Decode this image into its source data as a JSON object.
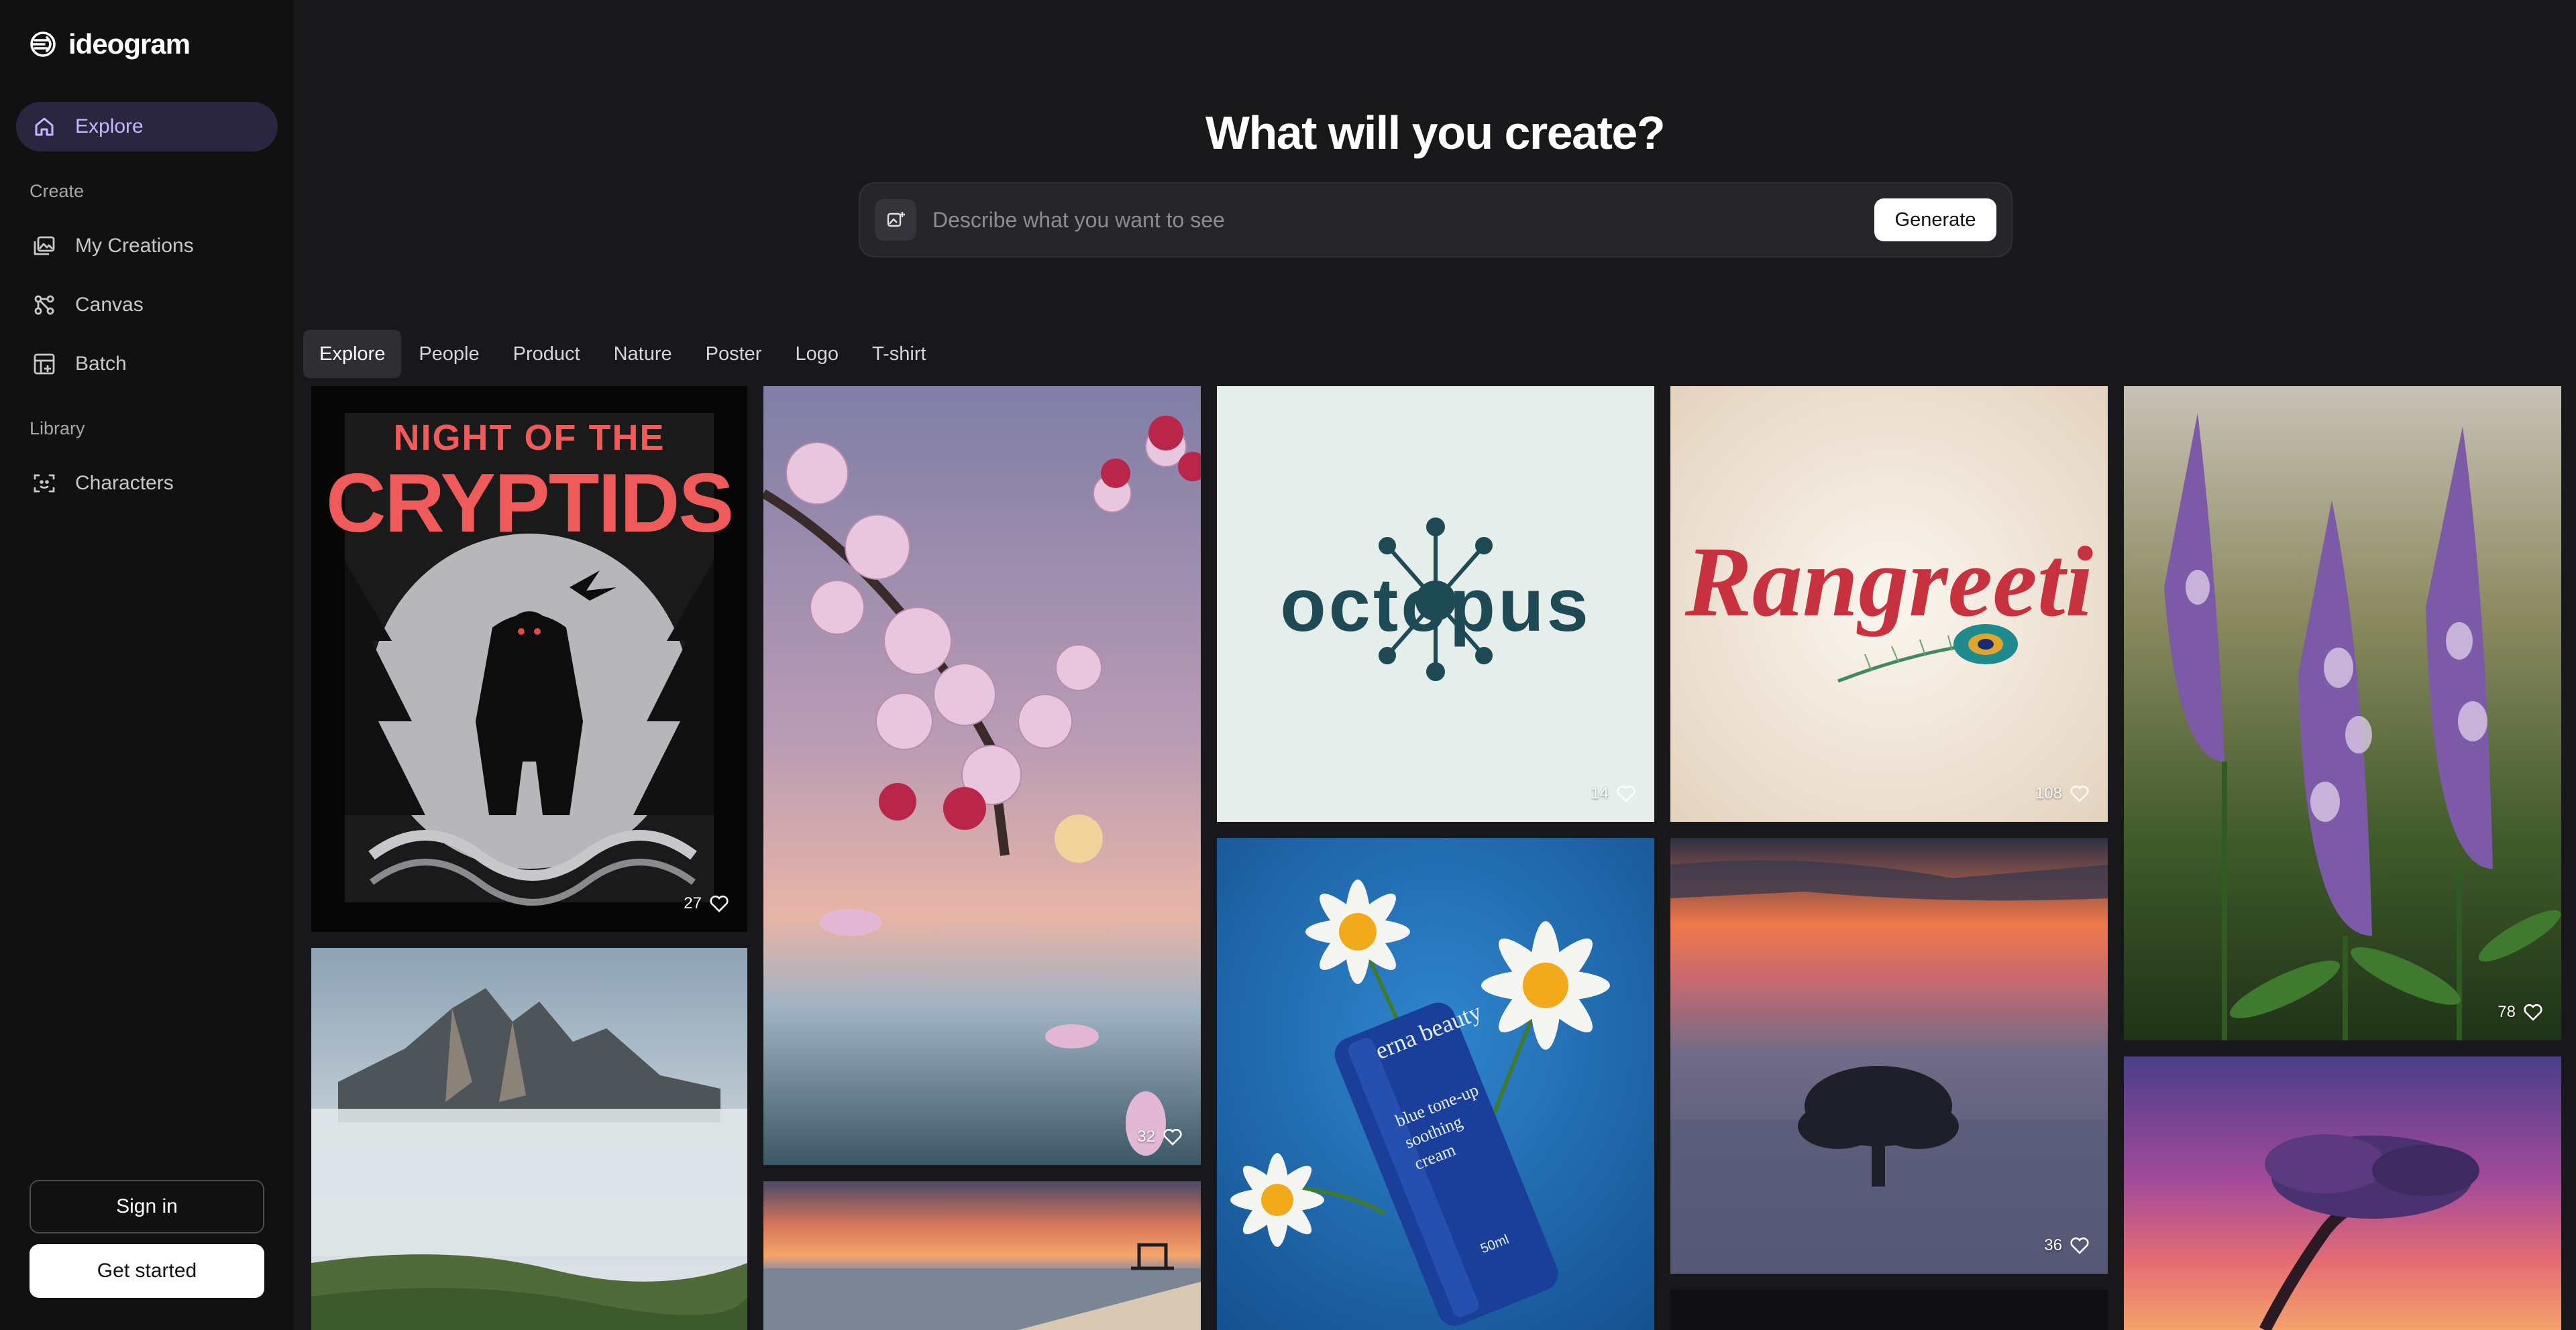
{
  "brand": {
    "name": "ideogram"
  },
  "sidebar": {
    "explore": "Explore",
    "section_create": "Create",
    "items_create": [
      "My Creations",
      "Canvas",
      "Batch"
    ],
    "section_library": "Library",
    "items_library": [
      "Characters"
    ],
    "sign_in": "Sign in",
    "get_started": "Get started"
  },
  "main": {
    "headline": "What will you create?",
    "prompt": {
      "placeholder": "Describe what you want to see",
      "generate": "Generate"
    },
    "tabs": [
      "Explore",
      "People",
      "Product",
      "Nature",
      "Poster",
      "Logo",
      "T-shirt"
    ],
    "active_tab": "Explore"
  },
  "gallery": {
    "cards": [
      {
        "title_line1": "NIGHT OF THE",
        "title_line2": "CRYPTIDS",
        "likes": "27"
      },
      {
        "likes": "32"
      },
      {
        "logo_text": "octopus",
        "likes": "14"
      },
      {
        "logo_text": "Rangreeti",
        "likes": "108"
      },
      {
        "likes": "78"
      },
      {
        "likes": ""
      },
      {
        "brand": "erna beauty",
        "line1": "blue tone-up",
        "line2": "soothing",
        "line3": "cream",
        "volume": "50ml",
        "likes": ""
      },
      {
        "likes": "36"
      },
      {
        "likes": ""
      },
      {
        "likes": ""
      }
    ]
  },
  "colors": {
    "accent": "#c8b6ff",
    "active_bg": "#2b2640",
    "sidebar_bg": "#111112",
    "main_bg": "#18181a"
  }
}
